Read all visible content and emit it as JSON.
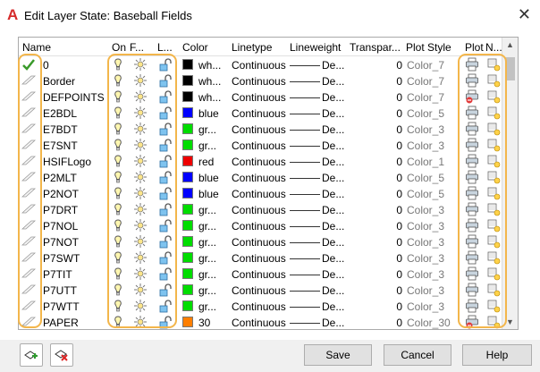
{
  "window": {
    "title": "Edit Layer State: Baseball Fields",
    "close_label": "✕",
    "app_icon_label": "A"
  },
  "columns": {
    "name": "Name",
    "on": "On",
    "freeze": "F...",
    "lock": "L...",
    "color": "Color",
    "linetype": "Linetype",
    "lineweight": "Lineweight",
    "transparency": "Transpar...",
    "plot_style": "Plot Style",
    "plot": "Plot",
    "new_vp_freeze": "N..."
  },
  "rows": [
    {
      "status": "current",
      "name": "0",
      "color_name": "wh...",
      "color_hex": "#000000",
      "linetype": "Continuous",
      "lineweight": "De...",
      "transparency": "0",
      "plot_style": "Color_7",
      "plot": true
    },
    {
      "status": "normal",
      "name": "Border",
      "color_name": "wh...",
      "color_hex": "#000000",
      "linetype": "Continuous",
      "lineweight": "De...",
      "transparency": "0",
      "plot_style": "Color_7",
      "plot": true
    },
    {
      "status": "normal",
      "name": "DEFPOINTS",
      "color_name": "wh...",
      "color_hex": "#000000",
      "linetype": "Continuous",
      "lineweight": "De...",
      "transparency": "0",
      "plot_style": "Color_7",
      "plot": false
    },
    {
      "status": "normal",
      "name": "E2BDL",
      "color_name": "blue",
      "color_hex": "#0000ff",
      "linetype": "Continuous",
      "lineweight": "De...",
      "transparency": "0",
      "plot_style": "Color_5",
      "plot": true
    },
    {
      "status": "normal",
      "name": "E7BDT",
      "color_name": "gr...",
      "color_hex": "#00dd00",
      "linetype": "Continuous",
      "lineweight": "De...",
      "transparency": "0",
      "plot_style": "Color_3",
      "plot": true
    },
    {
      "status": "normal",
      "name": "E7SNT",
      "color_name": "gr...",
      "color_hex": "#00dd00",
      "linetype": "Continuous",
      "lineweight": "De...",
      "transparency": "0",
      "plot_style": "Color_3",
      "plot": true
    },
    {
      "status": "normal",
      "name": "HSIFLogo",
      "color_name": "red",
      "color_hex": "#ee0000",
      "linetype": "Continuous",
      "lineweight": "De...",
      "transparency": "0",
      "plot_style": "Color_1",
      "plot": true
    },
    {
      "status": "normal",
      "name": "P2MLT",
      "color_name": "blue",
      "color_hex": "#0000ff",
      "linetype": "Continuous",
      "lineweight": "De...",
      "transparency": "0",
      "plot_style": "Color_5",
      "plot": true
    },
    {
      "status": "normal",
      "name": "P2NOT",
      "color_name": "blue",
      "color_hex": "#0000ff",
      "linetype": "Continuous",
      "lineweight": "De...",
      "transparency": "0",
      "plot_style": "Color_5",
      "plot": true
    },
    {
      "status": "normal",
      "name": "P7DRT",
      "color_name": "gr...",
      "color_hex": "#00dd00",
      "linetype": "Continuous",
      "lineweight": "De...",
      "transparency": "0",
      "plot_style": "Color_3",
      "plot": true
    },
    {
      "status": "normal",
      "name": "P7NOL",
      "color_name": "gr...",
      "color_hex": "#00dd00",
      "linetype": "Continuous",
      "lineweight": "De...",
      "transparency": "0",
      "plot_style": "Color_3",
      "plot": true
    },
    {
      "status": "normal",
      "name": "P7NOT",
      "color_name": "gr...",
      "color_hex": "#00dd00",
      "linetype": "Continuous",
      "lineweight": "De...",
      "transparency": "0",
      "plot_style": "Color_3",
      "plot": true
    },
    {
      "status": "normal",
      "name": "P7SWT",
      "color_name": "gr...",
      "color_hex": "#00dd00",
      "linetype": "Continuous",
      "lineweight": "De...",
      "transparency": "0",
      "plot_style": "Color_3",
      "plot": true
    },
    {
      "status": "normal",
      "name": "P7TIT",
      "color_name": "gr...",
      "color_hex": "#00dd00",
      "linetype": "Continuous",
      "lineweight": "De...",
      "transparency": "0",
      "plot_style": "Color_3",
      "plot": true
    },
    {
      "status": "normal",
      "name": "P7UTT",
      "color_name": "gr...",
      "color_hex": "#00dd00",
      "linetype": "Continuous",
      "lineweight": "De...",
      "transparency": "0",
      "plot_style": "Color_3",
      "plot": true
    },
    {
      "status": "normal",
      "name": "P7WTT",
      "color_name": "gr...",
      "color_hex": "#00dd00",
      "linetype": "Continuous",
      "lineweight": "De...",
      "transparency": "0",
      "plot_style": "Color_3",
      "plot": true
    },
    {
      "status": "normal",
      "name": "PAPER",
      "color_name": "30",
      "color_hex": "#ff7f00",
      "linetype": "Continuous",
      "lineweight": "De...",
      "transparency": "0",
      "plot_style": "Color_30",
      "plot": false
    }
  ],
  "buttons": {
    "save": "Save",
    "cancel": "Cancel",
    "help": "Help"
  },
  "icons": {
    "add_layers": "add-layers-icon",
    "remove_layers": "remove-layers-icon"
  },
  "highlight_color": "#f3b64b"
}
